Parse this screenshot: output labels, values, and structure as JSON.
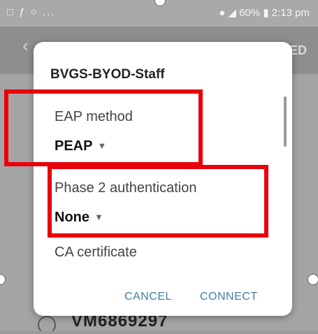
{
  "status_bar": {
    "left_icons": "□ ƒ ○ ...",
    "right_text": "● ◢ 60% ▮ 2:13 pm"
  },
  "app_bar": {
    "action_fragment": "ED"
  },
  "background": {
    "peek_text": "VM6869297"
  },
  "dialog": {
    "title": "BVGS-BYOD-Staff",
    "eap_method": {
      "label": "EAP method",
      "value": "PEAP"
    },
    "phase2": {
      "label": "Phase 2 authentication",
      "value": "None"
    },
    "ca_certificate": {
      "label": "CA certificate"
    },
    "buttons": {
      "cancel": "CANCEL",
      "connect": "CONNECT"
    }
  },
  "colors": {
    "highlight": "#e8000b",
    "button_text": "#3d7fa6"
  }
}
